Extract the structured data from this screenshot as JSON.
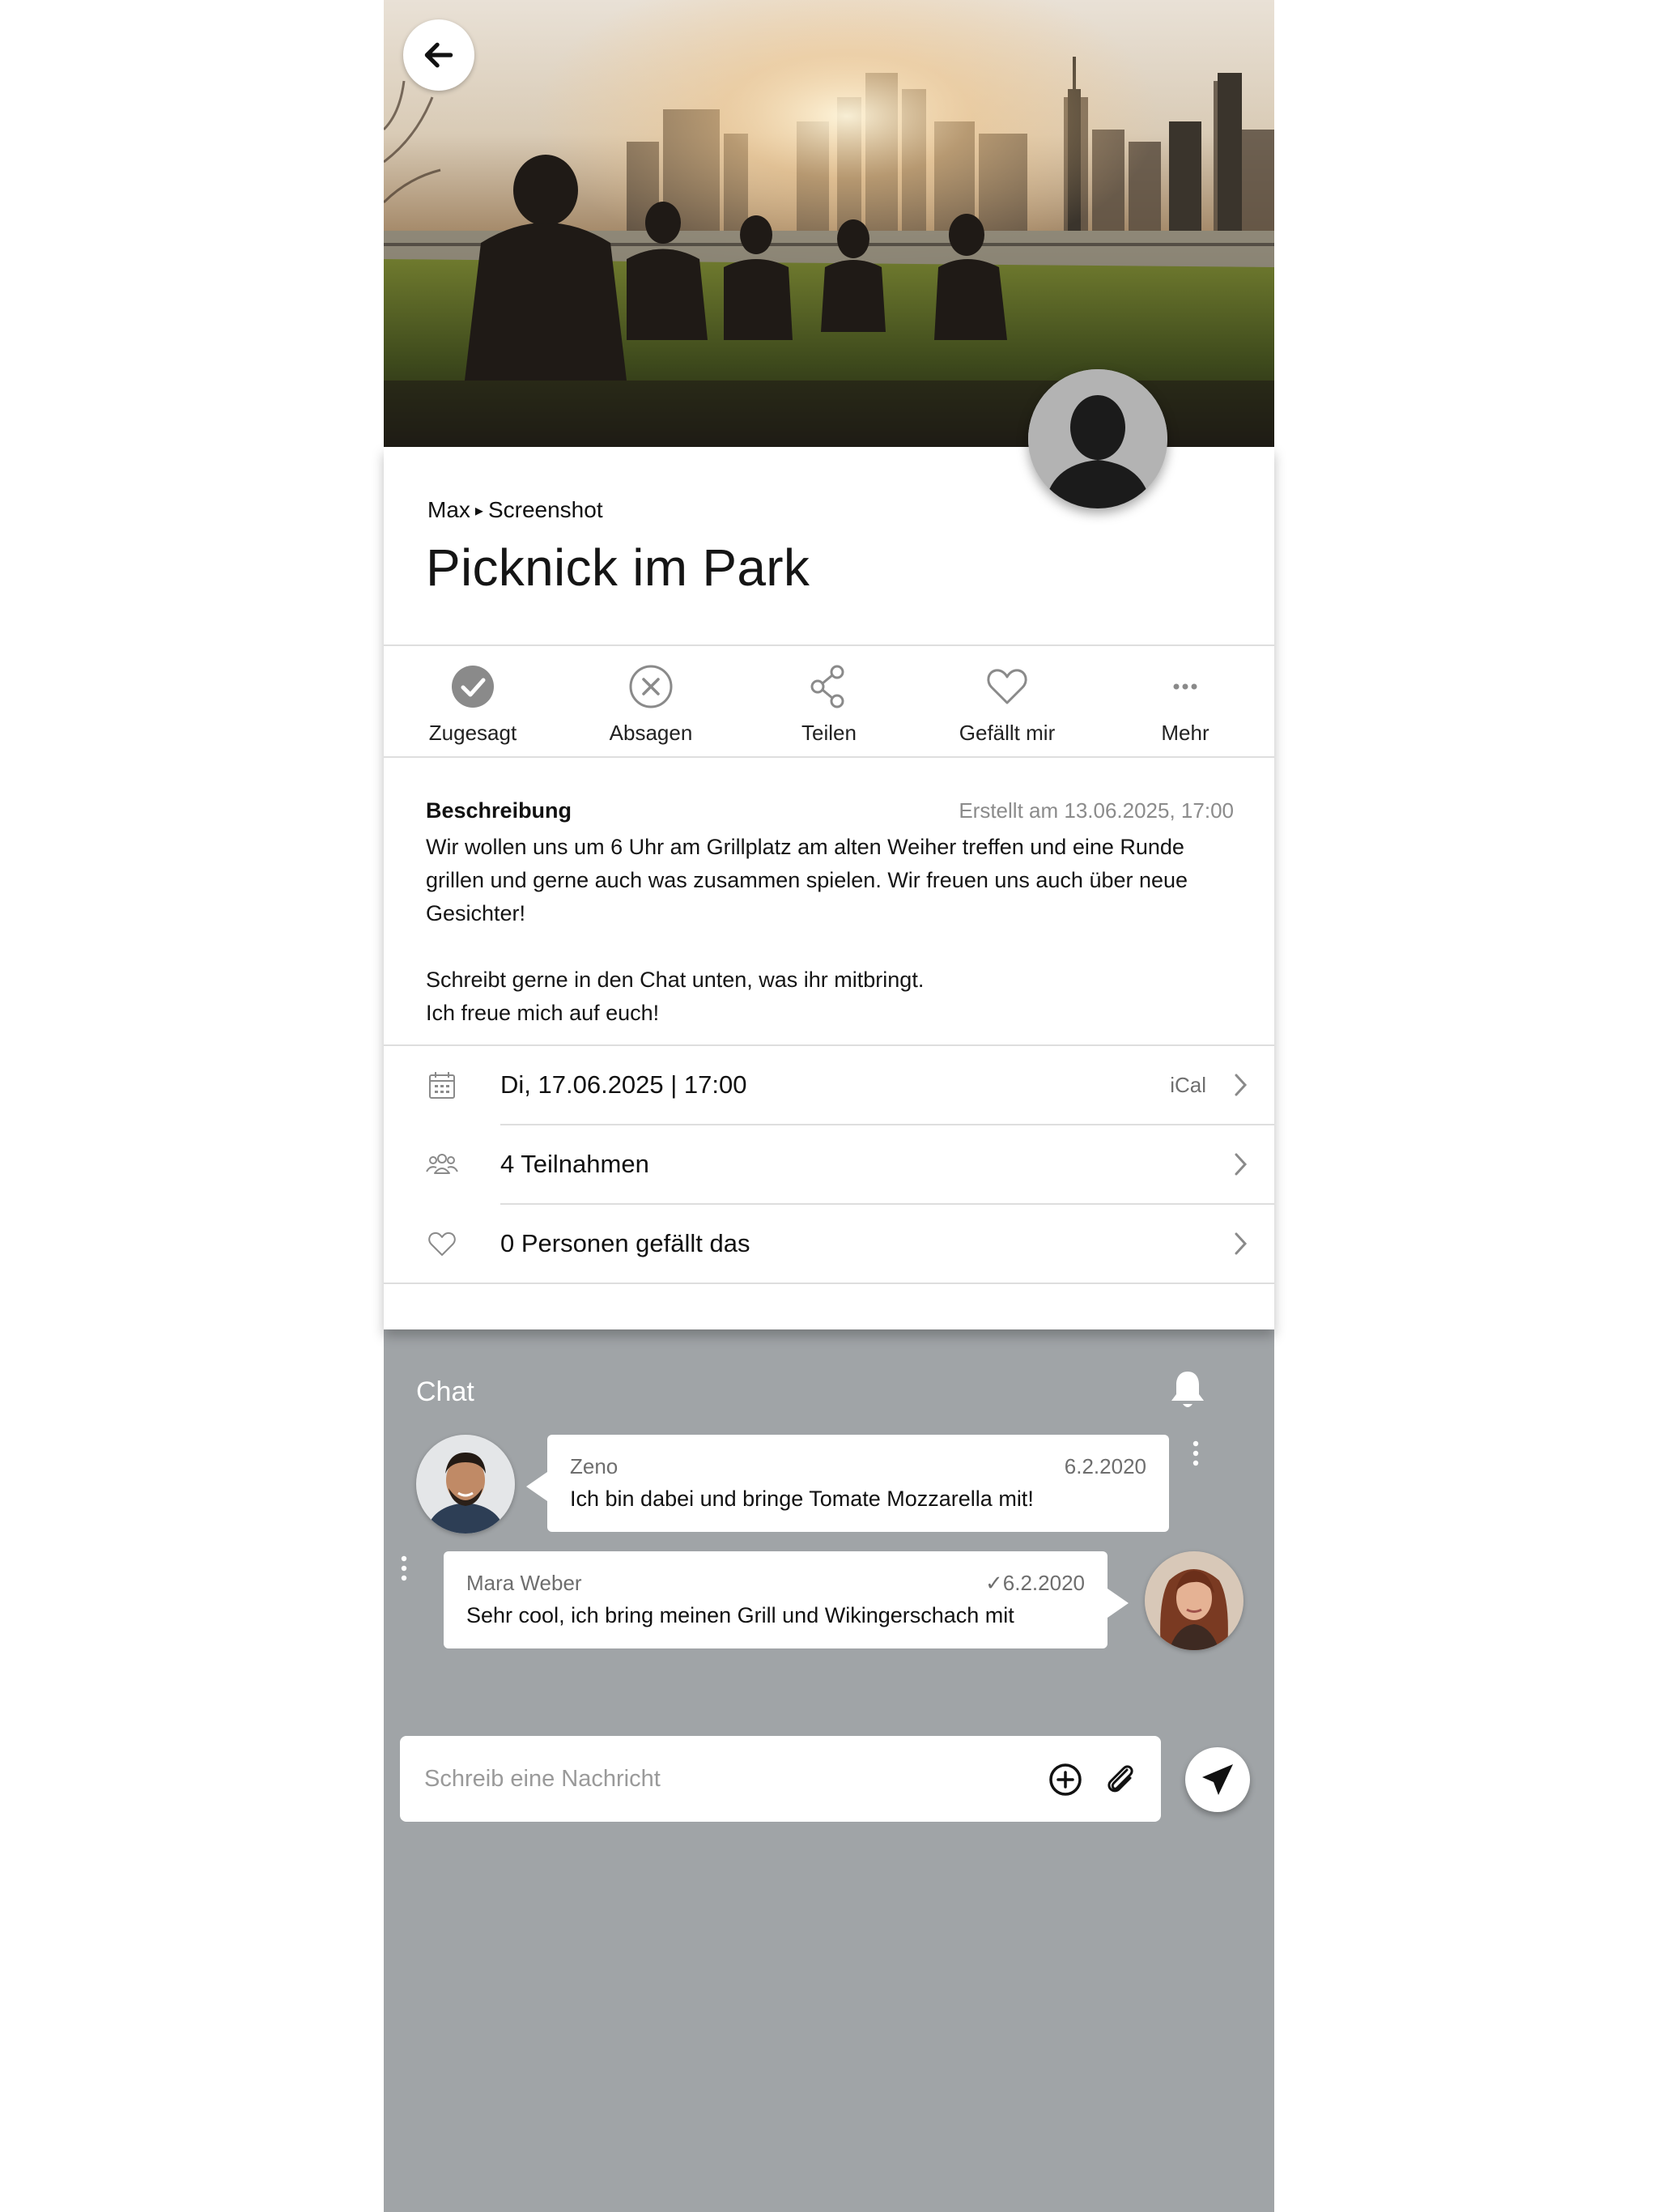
{
  "event": {
    "breadcrumb": {
      "group": "Max",
      "separator": "▸",
      "page": "Screenshot"
    },
    "title": "Picknick im Park"
  },
  "actions": [
    {
      "label": "Zugesagt",
      "icon": "check-circle-icon"
    },
    {
      "label": "Absagen",
      "icon": "cancel-circle-icon"
    },
    {
      "label": "Teilen",
      "icon": "share-icon"
    },
    {
      "label": "Gefällt mir",
      "icon": "heart-icon"
    },
    {
      "label": "Mehr",
      "icon": "more-dots-icon"
    }
  ],
  "description": {
    "label": "Beschreibung",
    "created": "Erstellt am 13.06.2025, 17:00",
    "paragraphs": [
      "Wir wollen uns um 6 Uhr am Grillplatz am alten Weiher treffen und eine Runde grillen und gerne auch was zusammen spielen. Wir freuen uns auch über neue Gesichter!",
      "Schreibt gerne in den Chat unten, was ihr mitbringt.\nIch freue mich auf euch!"
    ]
  },
  "details": {
    "date": "Di, 17.06.2025 | 17:00",
    "ical": "iCal",
    "participants": "4 Teilnahmen",
    "likes": "0 Personen gefällt das"
  },
  "chat": {
    "title": "Chat",
    "messages": [
      {
        "sender": "Zeno",
        "date": "6.2.2020",
        "text": "Ich bin dabei und bringe Tomate Mozzarella mit!"
      },
      {
        "sender": "Mara Weber",
        "date": "6.2.2020",
        "read": "✓",
        "text": "Sehr cool, ich bring meinen Grill und Wikingerschach mit"
      }
    ],
    "composer": {
      "placeholder": "Schreib eine Nachricht"
    }
  },
  "colors": {
    "chat_background": "#a0a4a7",
    "icon_gray": "#8a8a8a",
    "text": "#111111"
  }
}
